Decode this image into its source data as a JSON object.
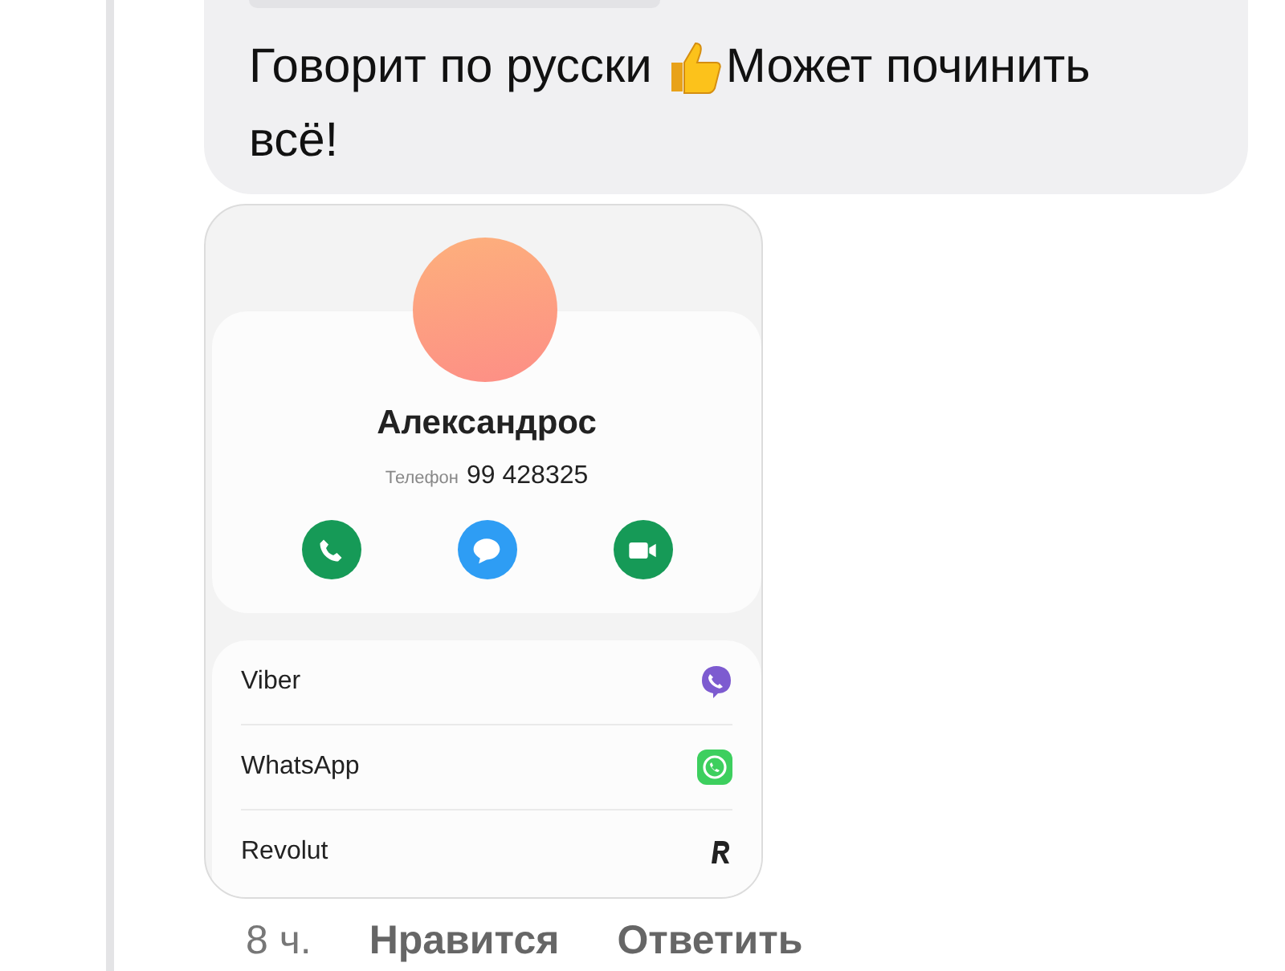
{
  "message": {
    "text_before": "Говорит по русски",
    "text_after": "Может починить",
    "text_line2": "всё!"
  },
  "contact_card": {
    "name": "Александрос",
    "phone_label": "Телефон",
    "phone": "99 428325",
    "actions": [
      {
        "kind": "call"
      },
      {
        "kind": "message"
      },
      {
        "kind": "video"
      }
    ],
    "apps": [
      {
        "label": "Viber",
        "kind": "viber"
      },
      {
        "label": "WhatsApp",
        "kind": "whatsapp"
      },
      {
        "label": "Revolut",
        "kind": "revolut"
      }
    ]
  },
  "footer": {
    "time": "8 ч.",
    "like": "Нравится",
    "reply": "Ответить"
  }
}
